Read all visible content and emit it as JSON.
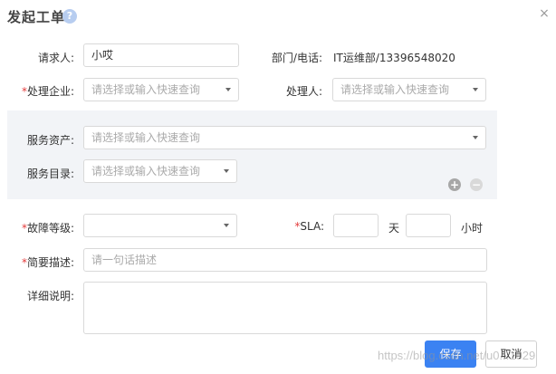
{
  "dialog": {
    "title": "发起工单",
    "help_icon": "?",
    "close_icon": "×"
  },
  "form": {
    "requester": {
      "label": "请求人:",
      "value": "小哎"
    },
    "dept_phone": {
      "label": "部门/电话:",
      "value": "IT运维部/13396548020"
    },
    "company": {
      "required_mark": "*",
      "label": "处理企业:",
      "placeholder": "请选择或输入快速查询"
    },
    "handler": {
      "label": "处理人:",
      "placeholder": "请选择或输入快速查询"
    },
    "service_asset": {
      "label": "服务资产:",
      "placeholder": "请选择或输入快速查询"
    },
    "service_catalog": {
      "label": "服务目录:",
      "placeholder": "请选择或输入快速查询"
    },
    "fault_level": {
      "required_mark": "*",
      "label": "故障等级:",
      "value": ""
    },
    "sla": {
      "required_mark": "*",
      "label": "SLA:",
      "days_value": "",
      "days_unit": "天",
      "hours_value": "",
      "hours_unit": "小时"
    },
    "brief": {
      "required_mark": "*",
      "label": "简要描述:",
      "placeholder": "请一句话描述"
    },
    "detail": {
      "label": "详细说明:",
      "value": ""
    },
    "asset_actions": {
      "add": "+",
      "remove": "−"
    }
  },
  "footer": {
    "save_label": "保存",
    "cancel_label": "取消"
  },
  "watermark": "https://blog.csdn.net/u0...1029"
}
